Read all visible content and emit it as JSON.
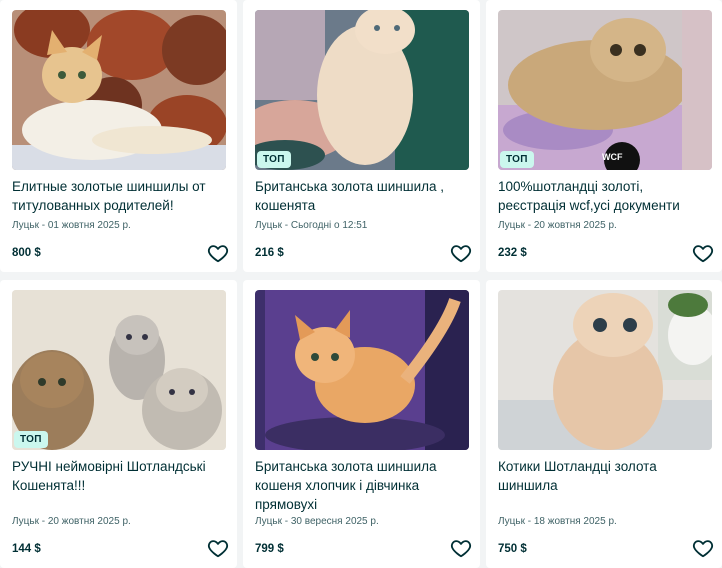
{
  "listings": [
    {
      "title": "Елитные золотые шиншилы от титулованных родителей!",
      "location_date": "Луцьк - 01 жовтня 2025 р.",
      "price": "800 $",
      "badge": "",
      "image": "golden-chinchilla-kitten-on-logs",
      "icon": "heart-icon"
    },
    {
      "title": "Британська золота шиншила , кошенята",
      "location_date": "Луцьк - Сьогодні о 12:51",
      "price": "216 $",
      "badge": "ТОП",
      "image": "kitten-held-in-hand",
      "icon": "heart-icon"
    },
    {
      "title": "100%шотландці золоті, реєстрація wcf,усі документи",
      "location_date": "Луцьк - 20 жовтня 2025 р.",
      "price": "232 $",
      "badge": "ТОП",
      "image": "scottish-fold-golden-cat-with-wcf-logo",
      "logo_text": "WCF",
      "icon": "heart-icon"
    },
    {
      "title": "РУЧНІ неймовірні Шотландські Кошенята!!!",
      "location_date": "Луцьк - 20 жовтня 2025 р.",
      "price": "144 $",
      "badge": "ТОП",
      "image": "three-scottish-kittens",
      "icon": "heart-icon"
    },
    {
      "title": "Британська золота шиншила кошеня хлопчик і дівчинка прямовухі",
      "location_date": "Луцьк - 30 вересня 2025 р.",
      "price": "799 $",
      "badge": "",
      "image": "golden-kitten-on-purple-background",
      "icon": "heart-icon"
    },
    {
      "title": "Котики Шотландці золота шиншила",
      "location_date": "Луцьк - 18 жовтня 2025 р.",
      "price": "750 $",
      "badge": "",
      "image": "scottish-fold-kitten-sitting",
      "icon": "heart-icon"
    }
  ],
  "colors": {
    "background": "#f2f4f5",
    "card": "#ffffff",
    "text": "#002f34",
    "badge_bg": "#cbf7ee",
    "meta": "#406367"
  }
}
